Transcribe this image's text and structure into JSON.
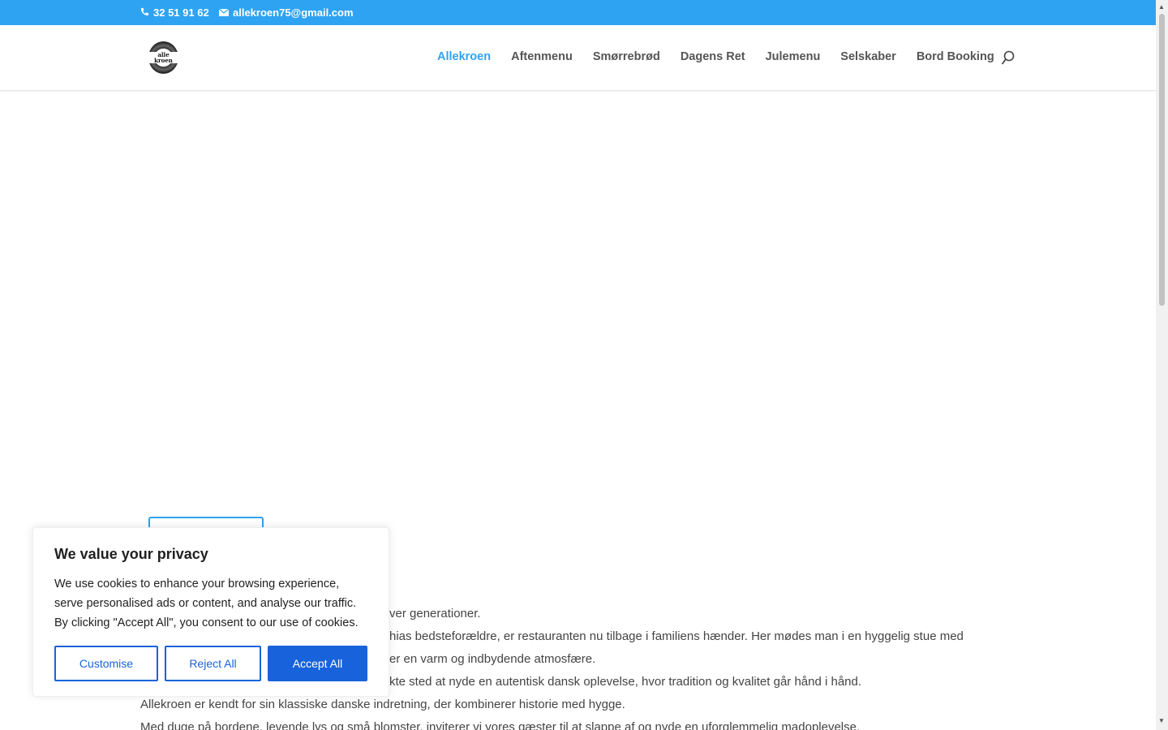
{
  "topbar": {
    "phone": "32 51 91 62",
    "email": "allekroen75@gmail.com",
    "phone_icon": "phone-icon",
    "email_icon": "envelope-icon"
  },
  "header": {
    "logo_text": "alle kroen",
    "nav": [
      "Allekroen",
      "Aftenmenu",
      "Smørrebrød",
      "Dagens Ret",
      "Julemenu",
      "Selskaber",
      "Bord Booking"
    ],
    "active_nav": "Allekroen",
    "search_icon": "search-icon"
  },
  "content": {
    "lines": [
      "ver generationer.",
      "hias bedsteforældre, er restauranten nu tilbage i familiens hænder. Her mødes man i en hyggelig stue med",
      "er en varm og indbydende atmosfære.",
      "kte sted at nyde en autentisk dansk oplevelse, hvor tradition og kvalitet går hånd i hånd.",
      "Allekroen er kendt for sin klassiske danske indretning, der kombinerer historie med hygge.",
      "Med duge på bordene, levende lys og små blomster, inviterer vi vores gæster til at slappe af og nyde en uforglemmelig madoplevelse."
    ]
  },
  "cookie": {
    "title": "We value your privacy",
    "message": "We use cookies to enhance your browsing experience, serve personalised ads or content, and analyse our traffic. By clicking \"Accept All\", you consent to our use of cookies.",
    "customise": "Customise",
    "reject": "Reject All",
    "accept": "Accept All"
  },
  "colors": {
    "accent": "#2ea3f2",
    "cookie_button": "#1863dc"
  }
}
